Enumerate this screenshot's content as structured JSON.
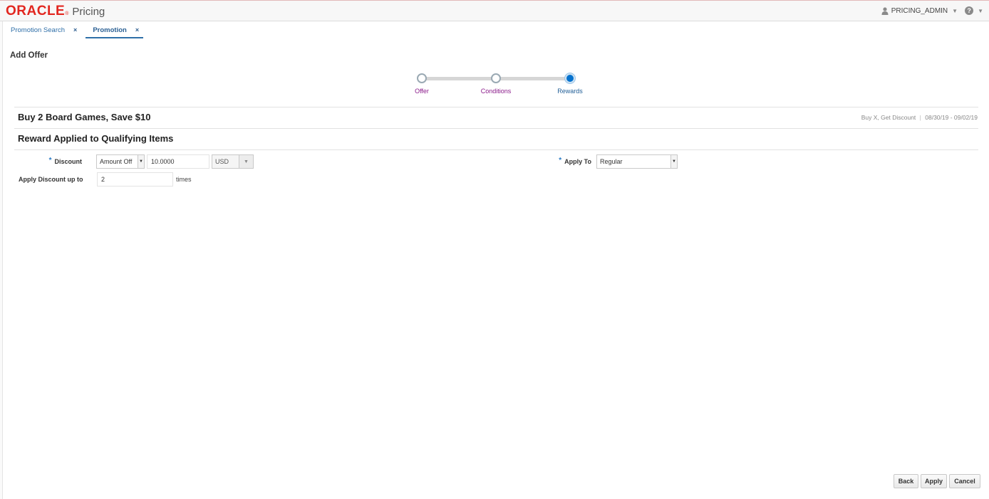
{
  "header": {
    "brand": "ORACLE",
    "brand_mark": "®",
    "product": "Pricing",
    "user_name": "PRICING_ADMIN",
    "help_symbol": "?",
    "icons": [
      "user-icon",
      "chevron-down-icon",
      "help-icon"
    ]
  },
  "tabs": [
    {
      "label": "Promotion Search",
      "close": "×"
    },
    {
      "label": "Promotion",
      "close": "×"
    }
  ],
  "page": {
    "title": "Add Offer"
  },
  "train": {
    "steps": [
      {
        "label": "Offer",
        "state": "visited"
      },
      {
        "label": "Conditions",
        "state": "visited"
      },
      {
        "label": "Rewards",
        "state": "current"
      }
    ]
  },
  "offer": {
    "name": "Buy 2 Board Games, Save $10",
    "type": "Buy X, Get Discount",
    "date_range": "08/30/19 - 09/02/19"
  },
  "reward": {
    "section_title": "Reward Applied to Qualifying Items",
    "discount_label": "Discount",
    "discount_type": "Amount Off",
    "discount_value": "10.0000",
    "currency": "USD",
    "apply_to_label": "Apply To",
    "apply_to": "Regular",
    "apply_up_to_label": "Apply Discount up to",
    "apply_up_to_value": "2",
    "times_suffix": "times",
    "required_mark": "*"
  },
  "buttons": {
    "back": "Back",
    "apply": "Apply",
    "cancel": "Cancel"
  },
  "colors": {
    "brand_red": "#e2261f",
    "link_blue": "#2f6fa8",
    "train_current": "#0572ce",
    "train_visited_label": "#8a1a8a"
  }
}
